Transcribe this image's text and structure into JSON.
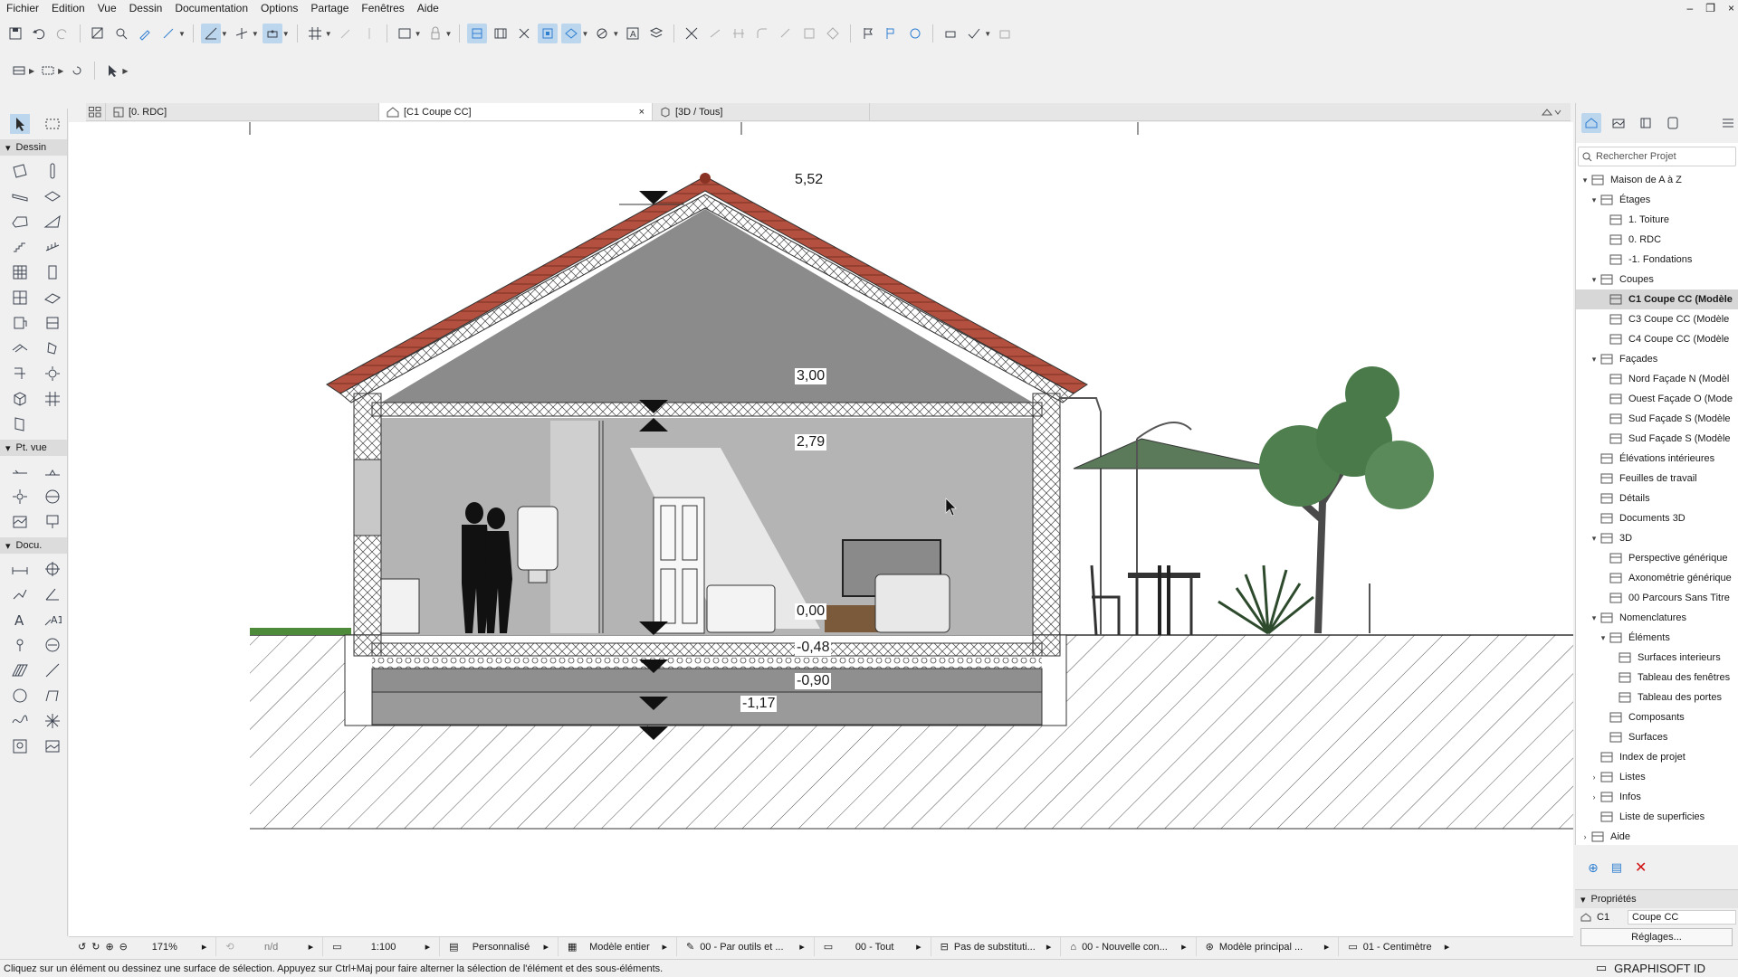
{
  "menu": [
    "Fichier",
    "Edition",
    "Vue",
    "Dessin",
    "Documentation",
    "Options",
    "Partage",
    "Fenêtres",
    "Aide"
  ],
  "window_controls": [
    "–",
    "❐",
    "×"
  ],
  "tabs": [
    {
      "label": "[0. RDC]",
      "icon": "floorplan-icon"
    },
    {
      "label": "[C1 Coupe CC]",
      "icon": "section-icon",
      "close": "×"
    },
    {
      "label": "[3D / Tous]",
      "icon": "3d-icon"
    }
  ],
  "palette": {
    "sections": [
      "Dessin",
      "Pt. vue",
      "Docu."
    ]
  },
  "drawing": {
    "levels": [
      "5,52",
      "3,00",
      "2,79",
      "0,00",
      "-0,48",
      "-0,90",
      "-1,17"
    ]
  },
  "navigator": {
    "search_placeholder": "Rechercher Projet",
    "tree": [
      {
        "label": "Maison de A à Z",
        "depth": 0,
        "caret": "▾",
        "icon": "project-icon"
      },
      {
        "label": "Étages",
        "depth": 1,
        "caret": "▾",
        "icon": "folder-icon"
      },
      {
        "label": "1. Toiture",
        "depth": 2,
        "caret": "",
        "icon": "story-icon"
      },
      {
        "label": "0. RDC",
        "depth": 2,
        "caret": "",
        "icon": "story-icon"
      },
      {
        "label": "-1. Fondations",
        "depth": 2,
        "caret": "",
        "icon": "story-icon"
      },
      {
        "label": "Coupes",
        "depth": 1,
        "caret": "▾",
        "icon": "folder-icon"
      },
      {
        "label": "C1 Coupe CC (Modèle",
        "depth": 2,
        "caret": "",
        "icon": "section-icon",
        "selected": true
      },
      {
        "label": "C3 Coupe CC (Modèle",
        "depth": 2,
        "caret": "",
        "icon": "section-icon"
      },
      {
        "label": "C4 Coupe CC (Modèle",
        "depth": 2,
        "caret": "",
        "icon": "section-icon"
      },
      {
        "label": "Façades",
        "depth": 1,
        "caret": "▾",
        "icon": "folder-icon"
      },
      {
        "label": "Nord Façade N (Modèl",
        "depth": 2,
        "caret": "",
        "icon": "elevation-icon"
      },
      {
        "label": "Ouest Façade O (Mode",
        "depth": 2,
        "caret": "",
        "icon": "elevation-icon"
      },
      {
        "label": "Sud Façade S (Modèle",
        "depth": 2,
        "caret": "",
        "icon": "elevation-icon"
      },
      {
        "label": "Sud Façade S (Modèle",
        "depth": 2,
        "caret": "",
        "icon": "elevation-icon"
      },
      {
        "label": "Élévations intérieures",
        "depth": 1,
        "caret": "",
        "icon": "interior-elevation-icon"
      },
      {
        "label": "Feuilles de travail",
        "depth": 1,
        "caret": "",
        "icon": "worksheet-icon"
      },
      {
        "label": "Détails",
        "depth": 1,
        "caret": "",
        "icon": "detail-icon"
      },
      {
        "label": "Documents 3D",
        "depth": 1,
        "caret": "",
        "icon": "3d-document-icon"
      },
      {
        "label": "3D",
        "depth": 1,
        "caret": "▾",
        "icon": "3d-icon"
      },
      {
        "label": "Perspective générique",
        "depth": 2,
        "caret": "",
        "icon": "perspective-icon"
      },
      {
        "label": "Axonométrie générique",
        "depth": 2,
        "caret": "",
        "icon": "axonometry-icon"
      },
      {
        "label": "00 Parcours Sans Titre",
        "depth": 2,
        "caret": "",
        "icon": "path-icon"
      },
      {
        "label": "Nomenclatures",
        "depth": 1,
        "caret": "▾",
        "icon": "schedule-icon"
      },
      {
        "label": "Éléments",
        "depth": 2,
        "caret": "▾",
        "icon": "elements-icon"
      },
      {
        "label": "Surfaces interieurs",
        "depth": 3,
        "caret": "",
        "icon": "table-icon"
      },
      {
        "label": "Tableau des fenêtres",
        "depth": 3,
        "caret": "",
        "icon": "table-icon"
      },
      {
        "label": "Tableau des portes",
        "depth": 3,
        "caret": "",
        "icon": "table-icon"
      },
      {
        "label": "Composants",
        "depth": 2,
        "caret": "",
        "icon": "components-icon"
      },
      {
        "label": "Surfaces",
        "depth": 2,
        "caret": "",
        "icon": "surfaces-icon"
      },
      {
        "label": "Index de projet",
        "depth": 1,
        "caret": "",
        "icon": "index-icon"
      },
      {
        "label": "Listes",
        "depth": 1,
        "caret": "›",
        "icon": "list-icon"
      },
      {
        "label": "Infos",
        "depth": 1,
        "caret": "›",
        "icon": "info-icon"
      },
      {
        "label": "Liste de superficies",
        "depth": 1,
        "caret": "",
        "icon": "area-list-icon"
      },
      {
        "label": "Aide",
        "depth": 0,
        "caret": "›",
        "icon": "help-icon"
      }
    ]
  },
  "properties": {
    "title": "Propriétés",
    "id": "C1",
    "name": "Coupe CC",
    "settings": "Réglages..."
  },
  "statusbar": {
    "zoom": "171%",
    "angle": "n/d",
    "scale": "1:100",
    "structure": "Personnalisé",
    "model": "Modèle entier",
    "pen": "00 - Par outils et ...",
    "layer": "00 - Tout",
    "override": "Pas de substituti...",
    "renovation": "00 - Nouvelle con...",
    "dimension": "Modèle principal ...",
    "unit": "01 - Centimètre"
  },
  "hint": "Cliquez sur un élément ou dessinez une surface de sélection. Appuyez sur Ctrl+Maj pour faire alterner la sélection de l'élément et des sous-éléments.",
  "brand": "GRAPHISOFT ID",
  "colors": {
    "roof_tile": "#b3503f",
    "wall_grey": "#a9a9a9",
    "interior_grey": "#b4b4b4",
    "accent_blue": "#2f7fd1"
  }
}
